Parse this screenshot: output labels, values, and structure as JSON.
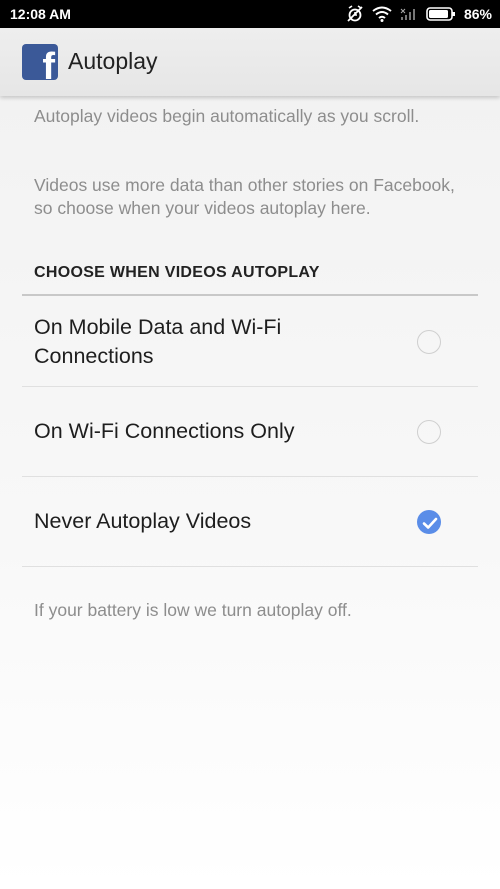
{
  "status_bar": {
    "time": "12:08 AM",
    "battery_percent": "86%",
    "icons": [
      "alarm-off-icon",
      "wifi-icon",
      "signal-icon",
      "battery-icon"
    ]
  },
  "app_bar": {
    "logo_letter": "f",
    "title": "Autoplay"
  },
  "descriptions": [
    "Autoplay videos begin automatically as you scroll.",
    "Videos use more data than other stories on Facebook, so choose when your videos autoplay here."
  ],
  "section": {
    "header": "CHOOSE WHEN VIDEOS AUTOPLAY",
    "options": [
      {
        "label": "On Mobile Data and Wi-Fi Connections",
        "selected": false
      },
      {
        "label": "On Wi-Fi Connections Only",
        "selected": false
      },
      {
        "label": "Never Autoplay Videos",
        "selected": true
      }
    ]
  },
  "footer_note": "If your battery is low we turn autoplay off.",
  "colors": {
    "facebook_blue": "#3b5998",
    "selected_radio": "#5a8de8",
    "secondary_text": "#8d8d8d"
  }
}
